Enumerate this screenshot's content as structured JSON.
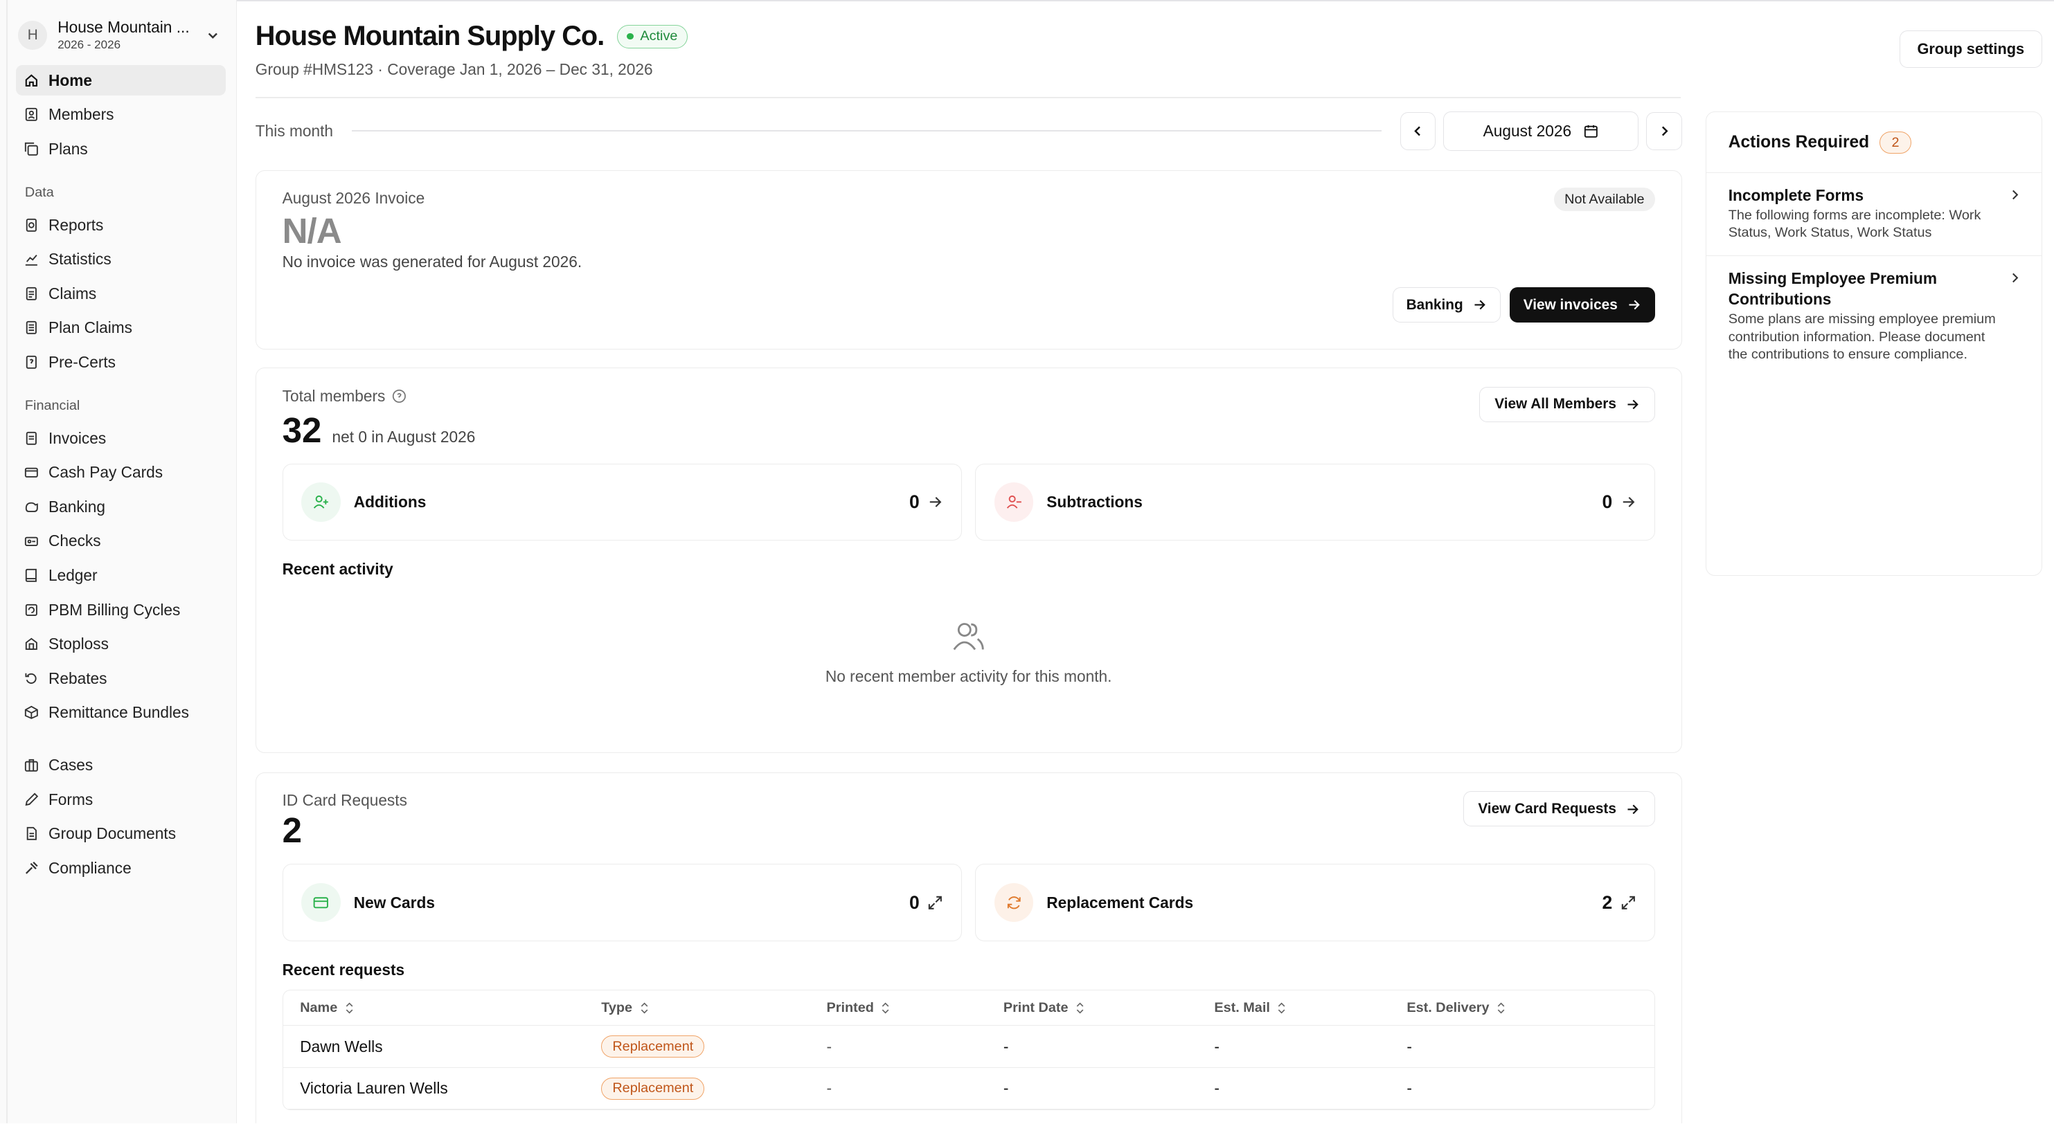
{
  "org": {
    "initial": "H",
    "name": "House Mountain ...",
    "years": "2026 - 2026"
  },
  "nav": {
    "main": [
      {
        "label": "Home",
        "icon": "home-icon",
        "active": true
      },
      {
        "label": "Members",
        "icon": "members-icon"
      },
      {
        "label": "Plans",
        "icon": "plans-icon"
      }
    ],
    "data_section": "Data",
    "data": [
      {
        "label": "Reports",
        "icon": "reports-icon"
      },
      {
        "label": "Statistics",
        "icon": "statistics-icon"
      },
      {
        "label": "Claims",
        "icon": "claims-icon"
      },
      {
        "label": "Plan Claims",
        "icon": "plan-claims-icon"
      },
      {
        "label": "Pre-Certs",
        "icon": "pre-certs-icon"
      }
    ],
    "financial_section": "Financial",
    "financial": [
      {
        "label": "Invoices",
        "icon": "invoices-icon"
      },
      {
        "label": "Cash Pay Cards",
        "icon": "card-icon"
      },
      {
        "label": "Banking",
        "icon": "banking-icon"
      },
      {
        "label": "Checks",
        "icon": "checks-icon"
      },
      {
        "label": "Ledger",
        "icon": "ledger-icon"
      },
      {
        "label": "PBM Billing Cycles",
        "icon": "billing-cycles-icon"
      },
      {
        "label": "Stoploss",
        "icon": "stoploss-icon"
      },
      {
        "label": "Rebates",
        "icon": "rebates-icon"
      },
      {
        "label": "Remittance Bundles",
        "icon": "bundles-icon"
      }
    ],
    "other": [
      {
        "label": "Cases",
        "icon": "cases-icon"
      },
      {
        "label": "Forms",
        "icon": "forms-icon"
      },
      {
        "label": "Group Documents",
        "icon": "documents-icon"
      },
      {
        "label": "Compliance",
        "icon": "compliance-icon"
      }
    ]
  },
  "header": {
    "title": "House Mountain Supply Co.",
    "status": "Active",
    "subtitle": "Group #HMS123 · Coverage Jan 1, 2026 – Dec 31, 2026",
    "settings_label": "Group settings"
  },
  "month": {
    "label": "This month",
    "selected": "August 2026"
  },
  "invoice": {
    "label": "August 2026 Invoice",
    "value": "N/A",
    "description": "No invoice was generated for August 2026.",
    "status": "Not Available",
    "banking_label": "Banking",
    "view_label": "View invoices"
  },
  "members": {
    "label": "Total members",
    "total": "32",
    "net": "net 0 in August 2026",
    "view_all_label": "View All Members",
    "additions": {
      "label": "Additions",
      "count": "0"
    },
    "subtractions": {
      "label": "Subtractions",
      "count": "0"
    },
    "recent_title": "Recent activity",
    "empty_text": "No recent member activity for this month."
  },
  "id_cards": {
    "label": "ID Card Requests",
    "total": "2",
    "view_label": "View Card Requests",
    "new_cards": {
      "label": "New Cards",
      "count": "0"
    },
    "replacement_cards": {
      "label": "Replacement Cards",
      "count": "2"
    },
    "recent_title": "Recent requests",
    "columns": [
      "Name",
      "Type",
      "Printed",
      "Print Date",
      "Est. Mail",
      "Est. Delivery"
    ],
    "rows": [
      {
        "name": "Dawn Wells",
        "type": "Replacement",
        "printed": "-",
        "print_date": "-",
        "est_mail": "-",
        "est_delivery": "-"
      },
      {
        "name": "Victoria Lauren Wells",
        "type": "Replacement",
        "printed": "-",
        "print_date": "-",
        "est_mail": "-",
        "est_delivery": "-"
      }
    ]
  },
  "actions_required": {
    "title": "Actions Required",
    "count": "2",
    "items": [
      {
        "title": "Incomplete Forms",
        "description": "The following forms are incomplete: Work Status, Work Status, Work Status"
      },
      {
        "title": "Missing Employee Premium Contributions",
        "description": "Some plans are missing employee premium contribution information. Please document the contributions to ensure compliance."
      }
    ]
  },
  "colors": {
    "accent_green": "#2bb24c",
    "accent_orange": "#c0561a",
    "dark_button": "#111111"
  }
}
